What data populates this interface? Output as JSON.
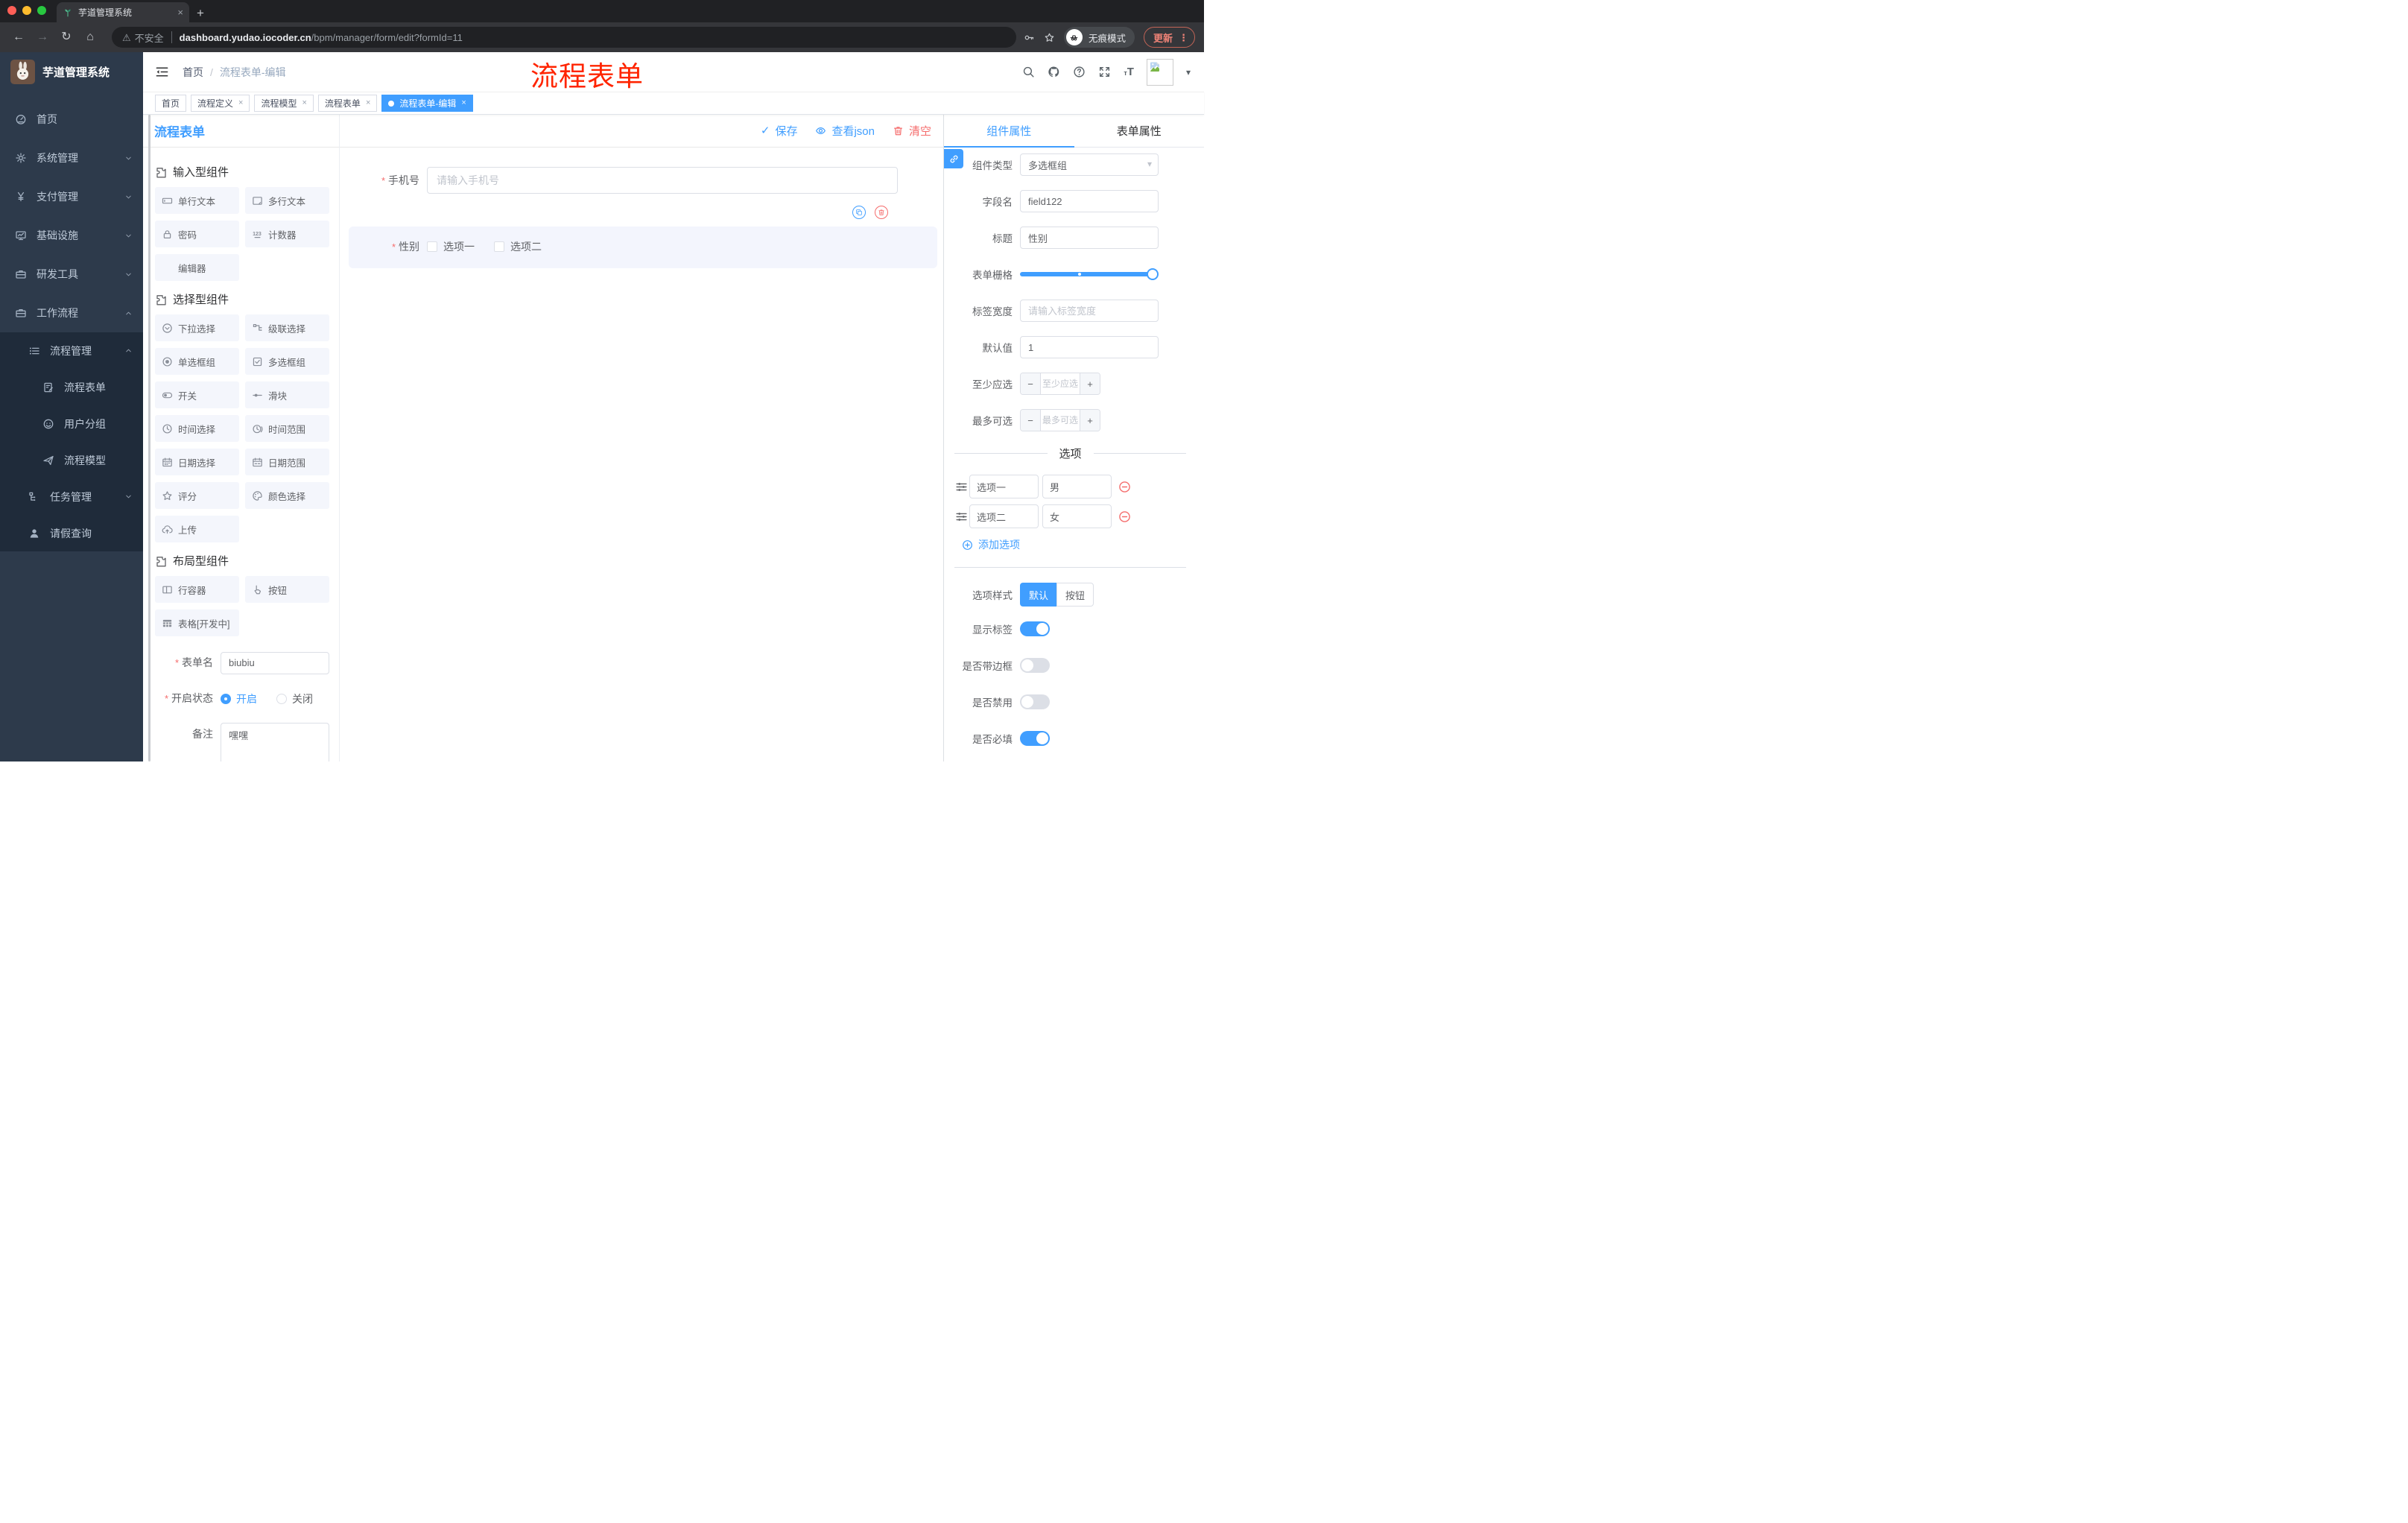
{
  "colors": {
    "accent": "#409eff",
    "danger": "#f56c6c",
    "annotation_red": "#ff2400",
    "sidebar_bg": "#2d3a4b",
    "submenu_bg": "#1f2b3a"
  },
  "browser": {
    "tab": {
      "title": "芋道管理系统",
      "favicon": "sprout-icon"
    },
    "url": {
      "security": "不安全",
      "host": "dashboard.yudao.iocoder.cn",
      "path": "/bpm/manager/form/edit?formId=11"
    },
    "incognito_label": "无痕模式",
    "update_label": "更新"
  },
  "header": {
    "breadcrumb": [
      "首页",
      "流程表单-编辑"
    ],
    "annotation": "流程表单",
    "icons": [
      "search-icon",
      "github-icon",
      "question-icon",
      "fullscreen-icon",
      "fontsize-icon"
    ]
  },
  "sidebar": {
    "title": "芋道管理系统",
    "items": [
      {
        "icon": "dashboard-icon",
        "label": "首页"
      },
      {
        "icon": "gear-icon",
        "label": "系统管理",
        "chevron": "down"
      },
      {
        "icon": "yen-icon",
        "label": "支付管理",
        "chevron": "down"
      },
      {
        "icon": "infra-icon",
        "label": "基础设施",
        "chevron": "down"
      },
      {
        "icon": "case-icon",
        "label": "研发工具",
        "chevron": "down"
      },
      {
        "icon": "case-icon",
        "label": "工作流程",
        "chevron": "up"
      }
    ],
    "submenu": [
      {
        "icon": "list-icon",
        "label": "流程管理",
        "chevron": "up",
        "level": 1
      },
      {
        "icon": "doc-edit-icon",
        "label": "流程表单",
        "level": 2
      },
      {
        "icon": "face-icon",
        "label": "用户分组",
        "level": 2
      },
      {
        "icon": "plane-icon",
        "label": "流程模型",
        "level": 2
      },
      {
        "icon": "tree-icon",
        "label": "任务管理",
        "chevron": "down",
        "level": 1
      },
      {
        "icon": "person-icon",
        "label": "请假查询",
        "level": 1
      }
    ]
  },
  "tags": [
    {
      "label": "首页",
      "closable": false,
      "active": false
    },
    {
      "label": "流程定义",
      "closable": true,
      "active": false
    },
    {
      "label": "流程模型",
      "closable": true,
      "active": false
    },
    {
      "label": "流程表单",
      "closable": true,
      "active": false
    },
    {
      "label": "流程表单-编辑",
      "closable": true,
      "active": true
    }
  ],
  "palette": {
    "title": "流程表单",
    "sections": [
      {
        "title": "输入型组件",
        "icon": "puzzle-icon",
        "items": [
          {
            "icon": "input-icon",
            "label": "单行文本"
          },
          {
            "icon": "textarea-icon",
            "label": "多行文本"
          },
          {
            "icon": "password-icon",
            "label": "密码"
          },
          {
            "icon": "counter-icon",
            "label": "计数器"
          },
          {
            "icon": "editor-icon",
            "label": "编辑器"
          }
        ]
      },
      {
        "title": "选择型组件",
        "icon": "puzzle-icon",
        "items": [
          {
            "icon": "select-icon",
            "label": "下拉选择"
          },
          {
            "icon": "cascader-icon",
            "label": "级联选择"
          },
          {
            "icon": "radio-icon",
            "label": "单选框组"
          },
          {
            "icon": "checkbox-icon",
            "label": "多选框组"
          },
          {
            "icon": "switch-icon",
            "label": "开关"
          },
          {
            "icon": "slider-icon",
            "label": "滑块"
          },
          {
            "icon": "time-icon",
            "label": "时间选择"
          },
          {
            "icon": "time-range-icon",
            "label": "时间范围"
          },
          {
            "icon": "date-icon",
            "label": "日期选择"
          },
          {
            "icon": "date-range-icon",
            "label": "日期范围"
          },
          {
            "icon": "rate-icon",
            "label": "评分"
          },
          {
            "icon": "color-icon",
            "label": "颜色选择"
          },
          {
            "icon": "upload-icon",
            "label": "上传"
          }
        ]
      },
      {
        "title": "布局型组件",
        "icon": "puzzle-icon",
        "items": [
          {
            "icon": "row-icon",
            "label": "行容器"
          },
          {
            "icon": "button-icon",
            "label": "按钮"
          },
          {
            "icon": "table-icon",
            "label": "表格[开发中]"
          }
        ]
      }
    ],
    "form": {
      "name": {
        "label": "表单名",
        "value": "biubiu"
      },
      "status": {
        "label": "开启状态",
        "options": [
          {
            "label": "开启",
            "checked": true
          },
          {
            "label": "关闭",
            "checked": false
          }
        ]
      },
      "remark": {
        "label": "备注",
        "value": "嘿嘿"
      }
    }
  },
  "canvas": {
    "toolbar": [
      {
        "icon": "check-icon",
        "label": "保存",
        "color": "blue"
      },
      {
        "icon": "eye-icon",
        "label": "查看json",
        "color": "blue"
      },
      {
        "icon": "trash-icon",
        "label": "清空",
        "color": "red"
      }
    ],
    "phone": {
      "label": "手机号",
      "placeholder": "请输入手机号"
    },
    "gender": {
      "label": "性别",
      "options": [
        "选项一",
        "选项二"
      ]
    }
  },
  "props": {
    "tabs": [
      {
        "label": "组件属性",
        "active": true
      },
      {
        "label": "表单属性",
        "active": false
      }
    ],
    "component_type": {
      "label": "组件类型",
      "value": "多选框组"
    },
    "field_name": {
      "label": "字段名",
      "value": "field122"
    },
    "title": {
      "label": "标题",
      "value": "性别"
    },
    "form_grid": {
      "label": "表单栅格"
    },
    "label_width": {
      "label": "标签宽度",
      "placeholder": "请输入标签宽度"
    },
    "default_value": {
      "label": "默认值",
      "value": "1"
    },
    "min_select": {
      "label": "至少应选",
      "placeholder": "至少应选"
    },
    "max_select": {
      "label": "最多可选",
      "placeholder": "最多可选"
    },
    "options_title": "选项",
    "options": [
      {
        "label": "选项一",
        "value": "男"
      },
      {
        "label": "选项二",
        "value": "女"
      }
    ],
    "add_option": "添加选项",
    "option_style": {
      "label": "选项样式",
      "choices": [
        "默认",
        "按钮"
      ],
      "selected": "默认"
    },
    "switches": [
      {
        "label": "显示标签",
        "on": true
      },
      {
        "label": "是否带边框",
        "on": false
      },
      {
        "label": "是否禁用",
        "on": false
      },
      {
        "label": "是否必填",
        "on": true
      }
    ]
  }
}
